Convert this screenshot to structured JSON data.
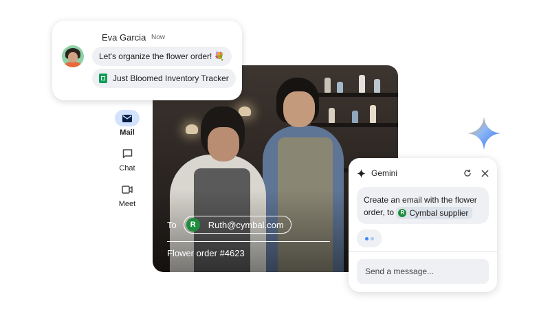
{
  "chat_card": {
    "sender_name": "Eva Garcia",
    "timestamp": "Now",
    "message": "Let's organize the flower order! 💐",
    "attachment": "Just Bloomed Inventory Tracker"
  },
  "nav_rail": {
    "items": [
      {
        "label": "Mail",
        "icon": "mail-icon",
        "active": true
      },
      {
        "label": "Chat",
        "icon": "chat-icon",
        "active": false
      },
      {
        "label": "Meet",
        "icon": "video-icon",
        "active": false
      }
    ]
  },
  "compose": {
    "to_label": "To",
    "recipient_initial": "R",
    "recipient_email": "Ruth@cymbal.com",
    "subject": "Flower order #4623"
  },
  "gemini": {
    "title": "Gemini",
    "prompt_text": "Create an email with the flower order, to",
    "prompt_chip_initial": "R",
    "prompt_chip": "Cymbal supplier",
    "input_placeholder": "Send a message..."
  },
  "colors": {
    "rail_active": "#d3e3fd",
    "avatar_green": "#1e8e3e",
    "sheets_green": "#0f9d58",
    "bubble_bg": "#eef0f3",
    "gemini_blue": "#4285f4"
  }
}
